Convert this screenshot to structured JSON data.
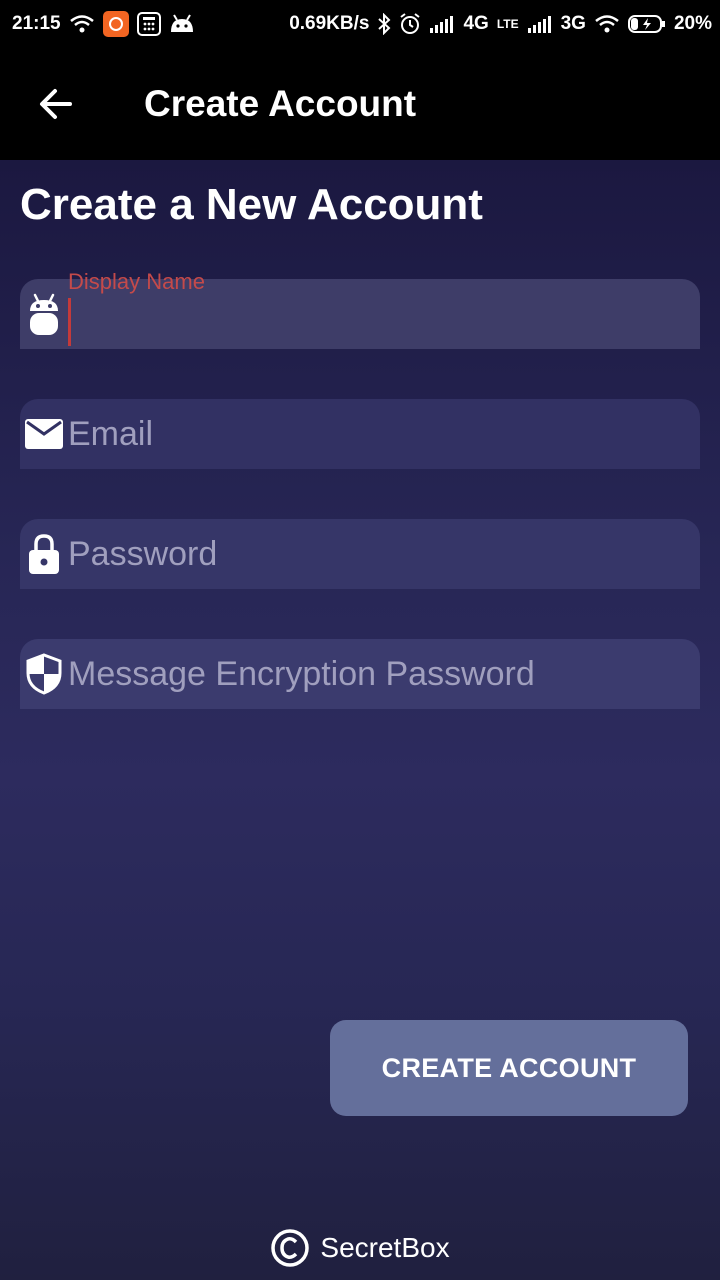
{
  "status_bar": {
    "time": "21:15",
    "net_speed": "0.69KB/s",
    "network1": "4G",
    "volte": "LTE",
    "network2": "3G",
    "battery": "20%"
  },
  "toolbar": {
    "back_icon": "arrow-left-icon",
    "title": "Create Account"
  },
  "page": {
    "heading": "Create a New Account"
  },
  "form": {
    "display_name": {
      "label": "Display Name",
      "value": "",
      "icon": "android-icon"
    },
    "email": {
      "placeholder": "Email",
      "value": "",
      "icon": "envelope-icon"
    },
    "password": {
      "placeholder": "Password",
      "value": "",
      "icon": "lock-icon"
    },
    "encryption_password": {
      "placeholder": "Message Encryption Password",
      "value": "",
      "icon": "shield-icon"
    }
  },
  "actions": {
    "create_label": "CREATE ACCOUNT"
  },
  "footer": {
    "brand": "SecretBox",
    "icon": "copyright-icon"
  },
  "colors": {
    "accent_error": "#c44a4a",
    "button": "#646f9b",
    "background_top": "#1b1840"
  }
}
